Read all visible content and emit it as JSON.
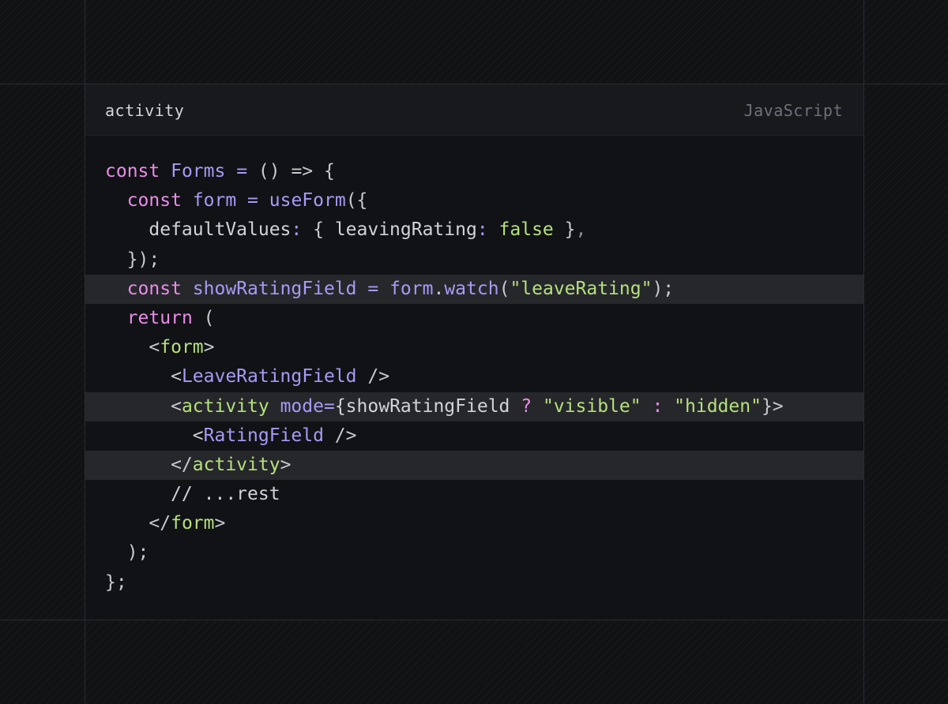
{
  "panel": {
    "title": "activity",
    "language": "JavaScript"
  },
  "colors": {
    "background": "#111214",
    "panel_header": "#18191c",
    "highlight_line": "#26272b",
    "keyword": "#e98ce8",
    "function": "#a79af6",
    "string": "#b5e07d",
    "text": "#d0d3da",
    "language_label": "#6e717a"
  },
  "code": {
    "highlighted_lines": [
      5,
      9,
      11
    ],
    "lines": [
      [
        {
          "t": "const",
          "c": "kw"
        },
        {
          "t": " ",
          "c": "var"
        },
        {
          "t": "Forms",
          "c": "fn"
        },
        {
          "t": " = ",
          "c": "op"
        },
        {
          "t": "() => {",
          "c": "pun"
        }
      ],
      [
        {
          "t": "  ",
          "c": "var"
        },
        {
          "t": "const",
          "c": "kw"
        },
        {
          "t": " ",
          "c": "var"
        },
        {
          "t": "form",
          "c": "fn"
        },
        {
          "t": " = ",
          "c": "op"
        },
        {
          "t": "useForm",
          "c": "fn"
        },
        {
          "t": "({",
          "c": "pun"
        }
      ],
      [
        {
          "t": "    defaultValues",
          "c": "var"
        },
        {
          "t": ": ",
          "c": "op"
        },
        {
          "t": "{ ",
          "c": "pun"
        },
        {
          "t": "leavingRating",
          "c": "var"
        },
        {
          "t": ": ",
          "c": "op"
        },
        {
          "t": "false",
          "c": "bool"
        },
        {
          "t": " }",
          "c": "pun"
        },
        {
          "t": ",",
          "c": "dim"
        }
      ],
      [
        {
          "t": "  });",
          "c": "pun"
        }
      ],
      [
        {
          "t": "  ",
          "c": "var"
        },
        {
          "t": "const",
          "c": "kw"
        },
        {
          "t": " ",
          "c": "var"
        },
        {
          "t": "showRatingField",
          "c": "fn"
        },
        {
          "t": " = ",
          "c": "op"
        },
        {
          "t": "form",
          "c": "fn"
        },
        {
          "t": ".",
          "c": "pun"
        },
        {
          "t": "watch",
          "c": "fn"
        },
        {
          "t": "(",
          "c": "pun"
        },
        {
          "t": "\"leaveRating\"",
          "c": "str"
        },
        {
          "t": ");",
          "c": "pun"
        }
      ],
      [
        {
          "t": "  ",
          "c": "var"
        },
        {
          "t": "return",
          "c": "kw"
        },
        {
          "t": " (",
          "c": "pun"
        }
      ],
      [
        {
          "t": "    <",
          "c": "pun"
        },
        {
          "t": "form",
          "c": "tag"
        },
        {
          "t": ">",
          "c": "pun"
        }
      ],
      [
        {
          "t": "      <",
          "c": "pun"
        },
        {
          "t": "LeaveRatingField",
          "c": "comp"
        },
        {
          "t": " />",
          "c": "pun"
        }
      ],
      [
        {
          "t": "      <",
          "c": "pun"
        },
        {
          "t": "activity",
          "c": "tag"
        },
        {
          "t": " ",
          "c": "var"
        },
        {
          "t": "mode",
          "c": "attr"
        },
        {
          "t": "=",
          "c": "op"
        },
        {
          "t": "{showRatingField ",
          "c": "var"
        },
        {
          "t": "?",
          "c": "kw"
        },
        {
          "t": " ",
          "c": "var"
        },
        {
          "t": "\"visible\"",
          "c": "str"
        },
        {
          "t": " ",
          "c": "var"
        },
        {
          "t": ":",
          "c": "kw"
        },
        {
          "t": " ",
          "c": "var"
        },
        {
          "t": "\"hidden\"",
          "c": "str"
        },
        {
          "t": "}>",
          "c": "pun"
        }
      ],
      [
        {
          "t": "        <",
          "c": "pun"
        },
        {
          "t": "RatingField",
          "c": "comp"
        },
        {
          "t": " />",
          "c": "pun"
        }
      ],
      [
        {
          "t": "      </",
          "c": "pun"
        },
        {
          "t": "activity",
          "c": "tag"
        },
        {
          "t": ">",
          "c": "pun"
        }
      ],
      [
        {
          "t": "      // ...rest",
          "c": "cmt"
        }
      ],
      [
        {
          "t": "    </",
          "c": "pun"
        },
        {
          "t": "form",
          "c": "tag"
        },
        {
          "t": ">",
          "c": "pun"
        }
      ],
      [
        {
          "t": "  );",
          "c": "pun"
        }
      ],
      [
        {
          "t": "};",
          "c": "pun"
        }
      ]
    ]
  }
}
